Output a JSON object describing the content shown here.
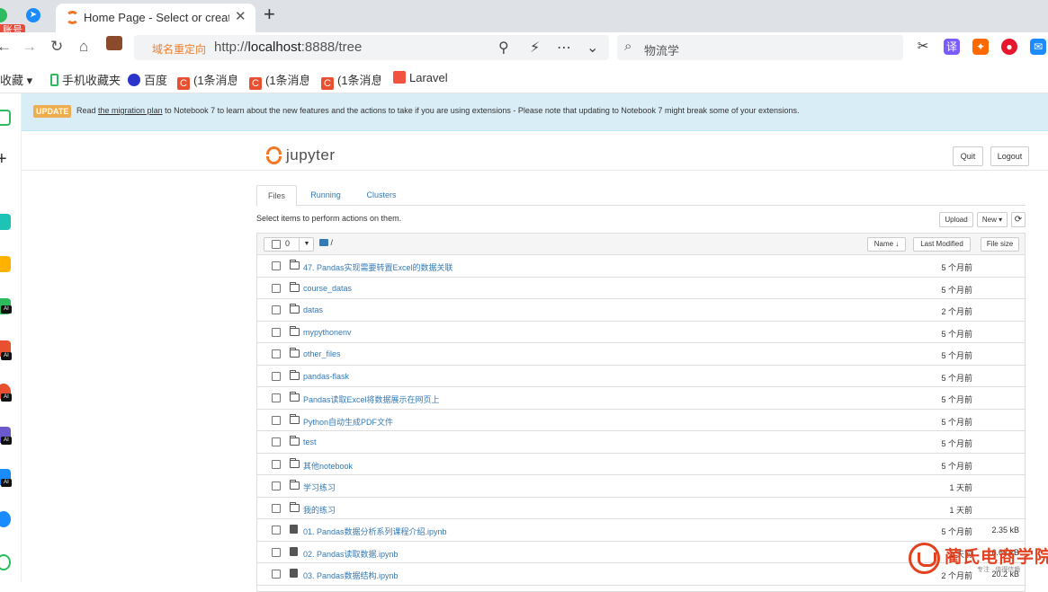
{
  "browser": {
    "account_badge": "账号",
    "active_tab_title": "Home Page - Select or create a notebook",
    "close_glyph": "✕",
    "new_tab_glyph": "+",
    "redirect_label": "域名重定向",
    "url_prefix": "http://",
    "url_host": "localhost",
    "url_rest": ":8888/tree",
    "search_query": "物流学",
    "bookmarks": [
      {
        "label": "收藏",
        "icon": "star-icon"
      },
      {
        "label": "手机收藏夹",
        "icon": "phone-icon"
      },
      {
        "label": "百度",
        "icon": "baidu-icon"
      },
      {
        "label": "(1条消息",
        "icon": "csdn-icon"
      },
      {
        "label": "(1条消息",
        "icon": "csdn-icon"
      },
      {
        "label": "(1条消息",
        "icon": "csdn-icon"
      },
      {
        "label": "Laravel",
        "icon": "laravel-icon"
      }
    ]
  },
  "banner": {
    "badge": "UPDATE",
    "text_before": "Read ",
    "link": "the migration plan",
    "text_after": " to Notebook 7 to learn about the new features and the actions to take if you are using extensions - Please note that updating to Notebook 7 might break some of your extensions."
  },
  "header": {
    "title": "jupyter",
    "quit": "Quit",
    "logout": "Logout"
  },
  "tabs": [
    {
      "label": "Files",
      "active": true
    },
    {
      "label": "Running",
      "active": false
    },
    {
      "label": "Clusters",
      "active": false
    }
  ],
  "toolbar": {
    "hint": "Select items to perform actions on them.",
    "upload": "Upload",
    "new": "New ▾",
    "refresh": "⟳"
  },
  "list_header": {
    "selected_count": "0",
    "breadcrumb": "/",
    "sort_name": "Name ↓",
    "last_modified": "Last Modified",
    "file_size": "File size"
  },
  "files": [
    {
      "type": "folder",
      "name": "47. Pandas实现需要转置Excel的数据关联",
      "modified": "5 个月前",
      "size": ""
    },
    {
      "type": "folder",
      "name": "course_datas",
      "modified": "5 个月前",
      "size": ""
    },
    {
      "type": "folder",
      "name": "datas",
      "modified": "2 个月前",
      "size": ""
    },
    {
      "type": "folder",
      "name": "mypythonenv",
      "modified": "5 个月前",
      "size": ""
    },
    {
      "type": "folder",
      "name": "other_files",
      "modified": "5 个月前",
      "size": ""
    },
    {
      "type": "folder",
      "name": "pandas-flask",
      "modified": "5 个月前",
      "size": ""
    },
    {
      "type": "folder",
      "name": "Pandas读取Excel将数据展示在网页上",
      "modified": "5 个月前",
      "size": ""
    },
    {
      "type": "folder",
      "name": "Python自动生成PDF文件",
      "modified": "5 个月前",
      "size": ""
    },
    {
      "type": "folder",
      "name": "test",
      "modified": "5 个月前",
      "size": ""
    },
    {
      "type": "folder",
      "name": "其他notebook",
      "modified": "5 个月前",
      "size": ""
    },
    {
      "type": "folder",
      "name": "学习练习",
      "modified": "1 天前",
      "size": ""
    },
    {
      "type": "folder",
      "name": "我的练习",
      "modified": "1 天前",
      "size": ""
    },
    {
      "type": "notebook",
      "name": "01. Pandas数据分析系列课程介绍.ipynb",
      "modified": "5 个月前",
      "size": "2.35 kB"
    },
    {
      "type": "notebook",
      "name": "02. Pandas读取数据.ipynb",
      "modified": "1 天前",
      "size": "6.63 kB"
    },
    {
      "type": "notebook",
      "name": "03. Pandas数据结构.ipynb",
      "modified": "2 个月前",
      "size": "20.2 kB"
    }
  ],
  "watermark": {
    "title": "蔺氏电商学院",
    "subtitle": "专注 · 值得信赖"
  }
}
